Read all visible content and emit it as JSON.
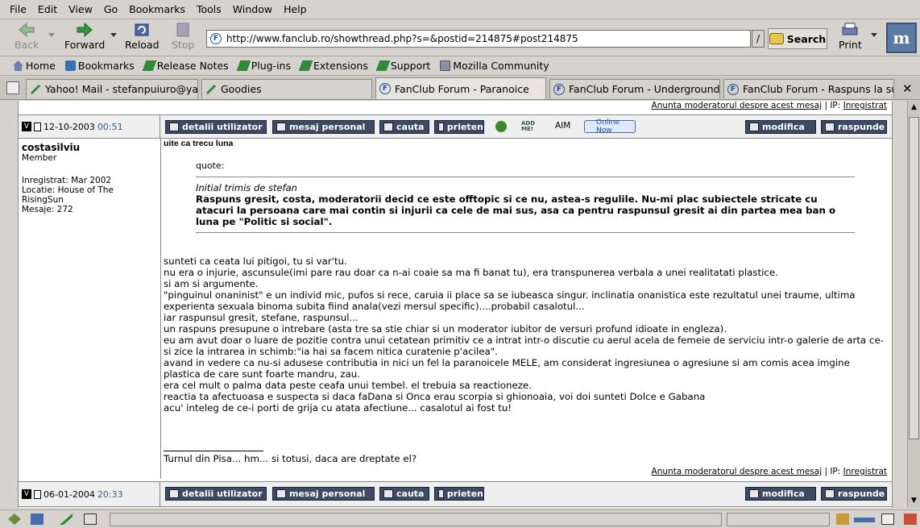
{
  "menu": [
    "File",
    "Edit",
    "View",
    "Go",
    "Bookmarks",
    "Tools",
    "Window",
    "Help"
  ],
  "nav": {
    "back": "Back",
    "forward": "Forward",
    "reload": "Reload",
    "stop": "Stop",
    "print": "Print"
  },
  "url": "http://www.fanclub.ro/showthread.php?s=&postid=214875#post214875",
  "search_label": "Search",
  "urldd": "/",
  "logo": "m",
  "personal": [
    "Home",
    "Bookmarks",
    "Release Notes",
    "Plug-ins",
    "Extensions",
    "Support",
    "Mozilla Community"
  ],
  "tabs": [
    "Yahoo! Mail - stefanpuiuro@ya...",
    "Goodies",
    "FanClub Forum - Paranoice",
    "FanClub Forum - Underground ...",
    "FanClub Forum - Raspuns la su..."
  ],
  "close_tab": "✕",
  "report_top": {
    "link": "Anunta moderatorul despre acest mesaj",
    "sep": " | IP: ",
    "ip": "Inregistrat"
  },
  "post1_bar": {
    "date": "12-10-2003",
    "time": "00:51"
  },
  "buttons": {
    "details": "detalii utilizator",
    "pm": "mesaj personal",
    "search": "cauta",
    "friend": "prieten",
    "edit": "modifica",
    "reply": "raspunde",
    "addme": "ADD ME!",
    "aim": "AIM",
    "online": "Online Now"
  },
  "user": {
    "name": "costasilviu",
    "role": "Member",
    "registered": "Inregistrat: Mar 2002",
    "location": "Locatie: House of The RisingSun",
    "posts": "Mesaje: 272"
  },
  "post": {
    "title": "uite ca trecu luna",
    "quote_label": "quote:",
    "quote_author": "Initial trimis de stefan",
    "quote_text": "Raspuns gresit, costa, moderatorii decid ce este offtopic si ce nu, astea-s regulile. Nu-mi plac subiectele stricate cu atacuri la persoana care mai contin si injurii ca cele de mai sus, asa ca pentru raspunsul gresit ai din partea mea ban o luna pe \"Politic si social\".",
    "lines": [
      "sunteti ca ceata lui pitigoi, tu si var'tu.",
      "nu era o injurie, ascunsule(imi pare rau doar ca n-ai coaie sa ma fi banat tu), era transpunerea verbala a unei realitatati plastice.",
      "si am si argumente.",
      "\"pinguinul onaninist\" e un individ mic, pufos si rece, caruia ii place sa se iubeasca singur. inclinatia onanistica este rezultatul unei traume, ultima experienta sexuala binoma subita fiind anala(vezi mersul specific)....probabil casalotul...",
      "iar raspunsul gresit, stefane, raspunsul...",
      "un raspuns presupune o intrebare (asta tre sa stie chiar si un moderator iubitor de versuri profund idioate in engleza).",
      "eu am avut doar o luare de pozitie contra unui cetatean primitiv ce a intrat intr-o discutie cu aerul acela de femeie de serviciu intr-o galerie de arta ce-si zice la intrarea in schimb:\"ia hai sa facem nitica curatenie p'acilea\".",
      "avand in vedere ca nu-si adusese contributia in nici un fel la paranoicele MELE, am considerat ingresiunea o agresiune si am comis acea imgine plastica de care sunt foarte mandru, zau.",
      "era cel mult o palma data peste ceafa unui tembel. el trebuia sa reactioneze.",
      "reactia ta afectuoasa e suspecta si daca faDana si Onca erau scorpia si ghionoaia, voi doi sunteti Dolce e Gabana",
      "acu' inteleg de ce-i porti de grija cu atata afectiune... casalotul ai fost tu!"
    ],
    "signature": "Turnul din Pisa... hm... si totusi, daca are dreptate el?"
  },
  "report_bottom": {
    "link": "Anunta moderatorul despre acest mesaj",
    "sep": " | IP: ",
    "ip": "Inregistrat"
  },
  "post2_bar": {
    "date": "06-01-2004",
    "time": "20:33"
  }
}
